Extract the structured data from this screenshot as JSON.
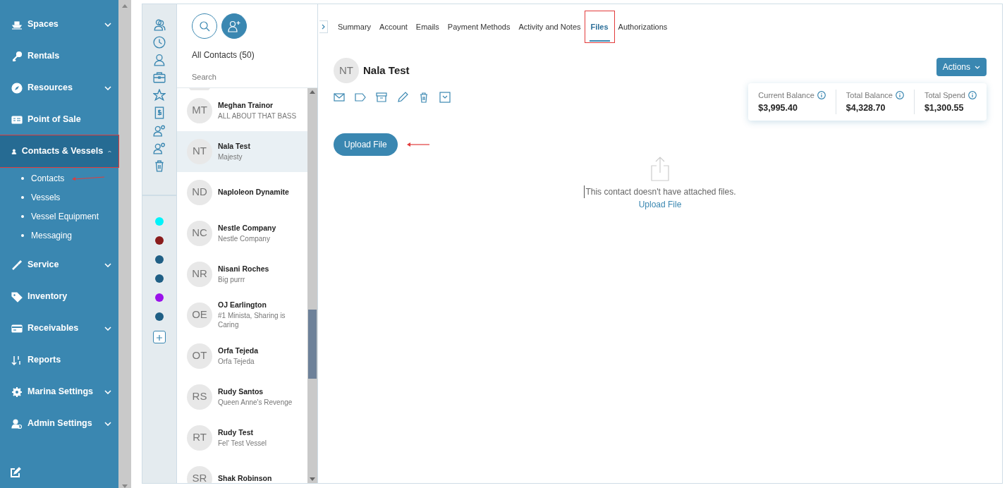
{
  "sidebar": {
    "items": [
      {
        "label": "Spaces",
        "expanded": false,
        "selected": false,
        "highlighted": false
      },
      {
        "label": "Rentals",
        "selected": false,
        "highlighted": false
      },
      {
        "label": "Resources",
        "expanded": false,
        "selected": false,
        "highlighted": false
      },
      {
        "label": "Point of Sale",
        "selected": false,
        "highlighted": false
      },
      {
        "label": "Contacts & Vessels",
        "expanded": true,
        "selected": true,
        "highlighted": true,
        "children": [
          {
            "label": "Contacts",
            "arrow": true
          },
          {
            "label": "Vessels",
            "arrow": false
          },
          {
            "label": "Vessel Equipment",
            "arrow": false
          },
          {
            "label": "Messaging",
            "arrow": false
          }
        ]
      },
      {
        "label": "Service",
        "expanded": false,
        "selected": false,
        "highlighted": false
      },
      {
        "label": "Inventory",
        "selected": false,
        "highlighted": false
      },
      {
        "label": "Receivables",
        "expanded": false,
        "selected": false,
        "highlighted": false
      },
      {
        "label": "Reports",
        "selected": false,
        "highlighted": false
      },
      {
        "label": "Marina Settings",
        "expanded": false,
        "selected": false,
        "highlighted": false
      },
      {
        "label": "Admin Settings",
        "expanded": false,
        "selected": false,
        "highlighted": false
      }
    ]
  },
  "tag_dots": [
    {
      "color": "#00f3fa"
    },
    {
      "color": "#8a1c1c"
    },
    {
      "color": "#1f5f85"
    },
    {
      "color": "#1f5f85"
    },
    {
      "color": "#9a12ea"
    },
    {
      "color": "#1f5f85"
    }
  ],
  "contacts": {
    "title": "All Contacts (50)",
    "search": {
      "placeholder": "Search"
    },
    "items": [
      {
        "initials": "MT",
        "name": "Meghan Trainor",
        "subtitle": "ALL ABOUT THAT BASS",
        "selected": false
      },
      {
        "initials": "NT",
        "name": "Nala Test",
        "subtitle": "Majesty",
        "selected": true
      },
      {
        "initials": "ND",
        "name": "Naploleon Dynamite",
        "selected": false
      },
      {
        "initials": "NC",
        "name": "Nestle Company",
        "subtitle": "Nestle Company",
        "selected": false
      },
      {
        "initials": "NR",
        "name": "Nisani Roches",
        "subtitle": "Big purrr",
        "selected": false
      },
      {
        "initials": "OE",
        "name": "OJ Earlington",
        "subtitle": "#1 Minista, Sharing is Caring",
        "selected": false
      },
      {
        "initials": "OT",
        "name": "Orfa Tejeda",
        "subtitle": "Orfa Tejeda",
        "selected": false
      },
      {
        "initials": "RS",
        "name": "Rudy Santos",
        "subtitle": "Queen Anne's Revenge",
        "selected": false
      },
      {
        "initials": "RT",
        "name": "Rudy Test",
        "subtitle": "Fel' Test Vessel",
        "selected": false
      },
      {
        "initials": "SR",
        "name": "Shak Robinson",
        "selected": false
      }
    ]
  },
  "tabs": [
    {
      "label": "Summary",
      "selected": false,
      "highlighted": false
    },
    {
      "label": "Account",
      "selected": false,
      "highlighted": false
    },
    {
      "label": "Emails",
      "selected": false,
      "highlighted": false
    },
    {
      "label": "Payment Methods",
      "selected": false,
      "highlighted": false
    },
    {
      "label": "Activity and Notes",
      "selected": false,
      "highlighted": false
    },
    {
      "label": "Files",
      "selected": true,
      "highlighted": true
    },
    {
      "label": "Authorizations",
      "selected": false,
      "highlighted": false
    }
  ],
  "contact": {
    "initials": "NT",
    "name": "Nala Test"
  },
  "actions_button": "Actions",
  "balances": [
    {
      "label": "Current Balance",
      "value": "$3,995.40"
    },
    {
      "label": "Total Balance",
      "value": "$4,328.70"
    },
    {
      "label": "Total Spend",
      "value": "$1,300.55"
    }
  ],
  "upload_button": {
    "label": "Upload File",
    "arrow": true
  },
  "empty_state": {
    "message": "This contact doesn't have attached files.",
    "link": "Upload File"
  }
}
